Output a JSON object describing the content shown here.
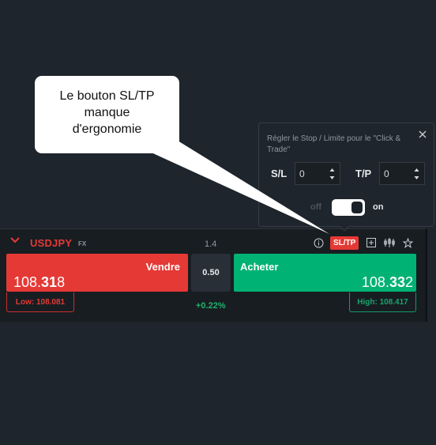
{
  "instrument": {
    "symbol": "USDJPY",
    "market": "FX",
    "spread_label": "1.4",
    "toolbar": {
      "info_icon": "info-icon",
      "sltp_label": "SL/TP",
      "add_icon": "plus-square-icon",
      "chart_icon": "candlestick-chart-icon",
      "favorite_icon": "star-icon"
    },
    "sell": {
      "label": "Vendre",
      "price_prefix": "108.",
      "price_big": "31",
      "price_suffix": "8",
      "low_label": "Low: 108.081"
    },
    "spread_box": "0.50",
    "change": "+0.22%",
    "buy": {
      "label": "Acheter",
      "price_prefix": "108.",
      "price_big": "33",
      "price_suffix": "2",
      "high_label": "High: 108.417"
    }
  },
  "sltp_panel": {
    "title": "Régler le Stop / Limite pour le \"Click & Trade\"",
    "sl_label": "S/L",
    "sl_value": "0",
    "tp_label": "T/P",
    "tp_value": "0",
    "off_label": "off",
    "on_label": "on",
    "toggle_state": "on"
  },
  "callout": {
    "lines": [
      "Le bouton SL/TP",
      "manque",
      "d'ergonomie"
    ]
  },
  "colors": {
    "sell": "#e53935",
    "buy": "#00b274",
    "background": "#1f252c",
    "widget": "#181d22"
  }
}
